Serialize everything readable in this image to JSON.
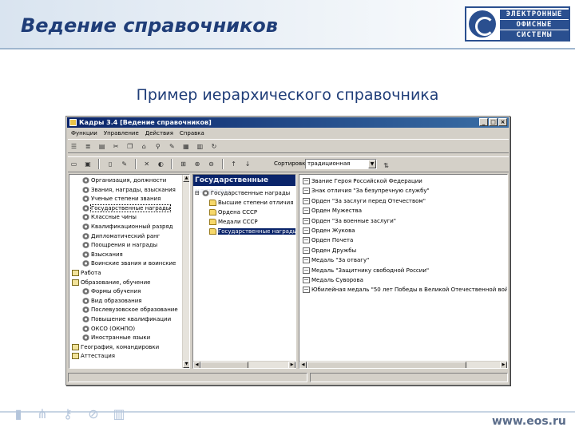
{
  "slide": {
    "title": "Ведение справочников",
    "subtitle": "Пример иерархического справочника",
    "logo_lines": [
      "ЭЛЕКТРОННЫЕ",
      "ОФИСНЫЕ",
      "СИСТЕМЫ"
    ],
    "site_url": "www.eos.ru"
  },
  "window": {
    "title": "Кадры 3.4  [Ведение справочников]",
    "controls": [
      "_",
      "□",
      "×"
    ]
  },
  "menu": [
    "Функции",
    "Управление",
    "Действия",
    "Справка"
  ],
  "toolbar": {
    "sort_label": "Сортировка:",
    "sort_value": "традиционная"
  },
  "left_tree": [
    {
      "label": "Организация, должности",
      "icon": "gear-icon"
    },
    {
      "label": "Звания, награды, взыскания",
      "icon": "gear-icon"
    },
    {
      "label": "Ученые степени звания",
      "icon": "gear-icon"
    },
    {
      "label": "Государственные награды",
      "icon": "gear-icon",
      "selected": true
    },
    {
      "label": "Классные чины",
      "icon": "gear-icon"
    },
    {
      "label": "Квалификационный разряд",
      "icon": "gear-icon"
    },
    {
      "label": "Дипломатический ранг",
      "icon": "gear-icon"
    },
    {
      "label": "Поощрения и награды",
      "icon": "gear-icon"
    },
    {
      "label": "Взыскания",
      "icon": "gear-icon"
    },
    {
      "label": "Воинские звания и воинские",
      "icon": "gear-icon"
    },
    {
      "label": "Работа",
      "icon": "book-icon"
    },
    {
      "label": "Образование, обучение",
      "icon": "book-icon"
    },
    {
      "label": "Формы обучения",
      "icon": "gear-icon"
    },
    {
      "label": "Вид образования",
      "icon": "gear-icon"
    },
    {
      "label": "Послевузовское образование",
      "icon": "gear-icon"
    },
    {
      "label": "Повышение квалификации",
      "icon": "gear-icon"
    },
    {
      "label": "ОКСО (ОКНПО)",
      "icon": "gear-icon"
    },
    {
      "label": "Иностранные языки",
      "icon": "gear-icon"
    },
    {
      "label": "География, командировки",
      "icon": "book-icon"
    },
    {
      "label": "Аттестация",
      "icon": "book-icon"
    }
  ],
  "mid_header": "Государственные награды",
  "mid_tree": [
    {
      "label": "Государственные награды",
      "icon": "gear-icon",
      "prefix": "⊟"
    },
    {
      "label": "Высшие степени отличия",
      "icon": "folder-icon"
    },
    {
      "label": "Ордена СССР",
      "icon": "folder-icon"
    },
    {
      "label": "Медали СССР",
      "icon": "folder-icon"
    },
    {
      "label": "Государственные награды",
      "icon": "folder-icon",
      "selected": true
    }
  ],
  "right_list": [
    "Звание Героя Российской Федерации",
    "Знак отличия \"За безупречную службу\"",
    "Орден \"За заслуги перед Отечеством\"",
    "Орден Мужества",
    "Орден \"За военные заслуги\"",
    "Орден Жукова",
    "Орден Почета",
    "Орден Дружбы",
    "Медаль \"За отвагу\"",
    "Медаль \"Защитнику свободной России\"",
    "Медаль Суворова",
    "Юбилейная медаль \"50 лет Победы в Великой Отечественной войне\""
  ],
  "colors": {
    "title_blue": "#1f3d78",
    "selection": "#0a246a",
    "window_face": "#d4d0c8"
  }
}
